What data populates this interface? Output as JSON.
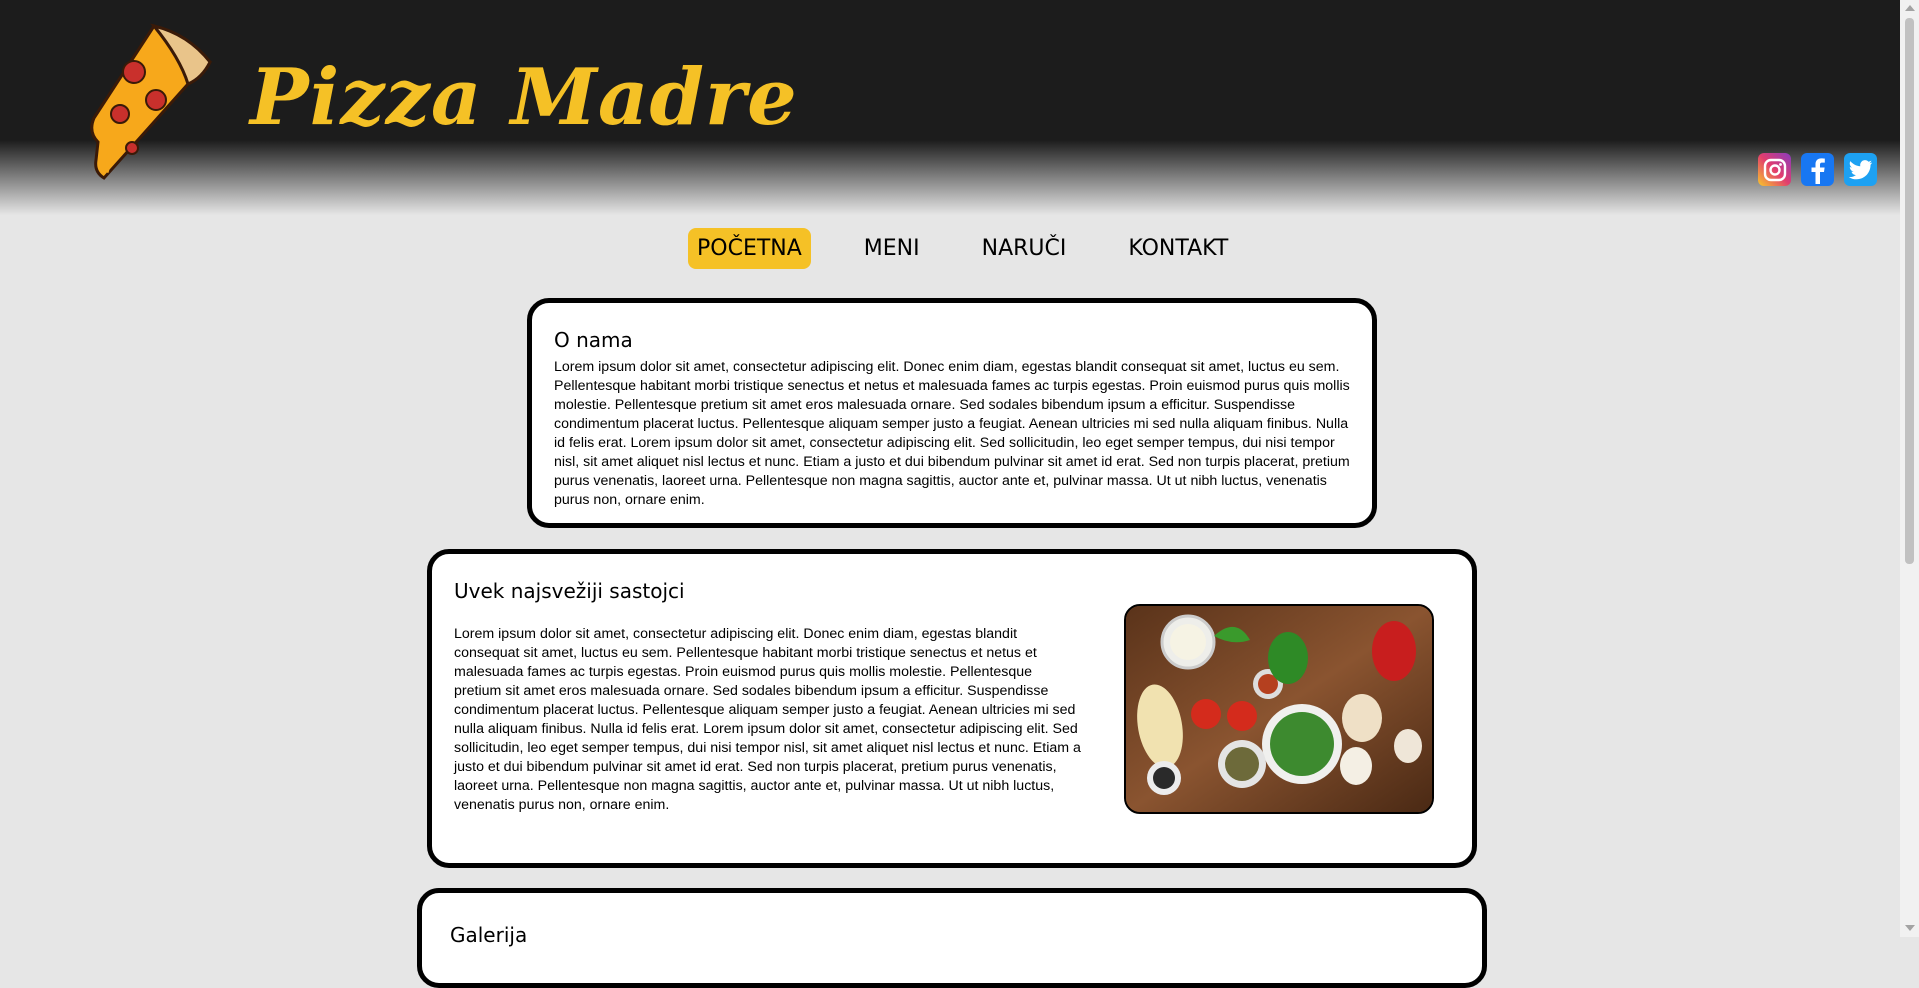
{
  "header": {
    "brand": "Pizza Madre",
    "logo_icon": "pizza-slice-icon",
    "brand_color": "#f5c126",
    "socials": [
      {
        "name": "instagram-icon"
      },
      {
        "name": "facebook-icon"
      },
      {
        "name": "twitter-icon"
      }
    ]
  },
  "nav": {
    "items": [
      {
        "label": "POČETNA",
        "active": true
      },
      {
        "label": "MENI"
      },
      {
        "label": "NARUČI"
      },
      {
        "label": "KONTAKT"
      }
    ],
    "active_color": "#f5c126"
  },
  "about": {
    "title": "O nama",
    "body": "Lorem ipsum dolor sit amet, consectetur adipiscing elit. Donec enim diam, egestas blandit consequat sit amet, luctus eu sem. Pellentesque habitant morbi tristique senectus et netus et malesuada fames ac turpis egestas. Proin euismod purus quis mollis molestie. Pellentesque pretium sit amet eros malesuada ornare. Sed sodales bibendum ipsum a efficitur. Suspendisse condimentum placerat luctus. Pellentesque aliquam semper justo a feugiat. Aenean ultricies mi sed nulla aliquam finibus. Nulla id felis erat. Lorem ipsum dolor sit amet, consectetur adipiscing elit. Sed sollicitudin, leo eget semper tempus, dui nisi tempor nisl, sit amet aliquet nisl lectus et nunc. Etiam a justo et dui bibendum pulvinar sit amet id erat. Sed non turpis placerat, pretium purus venenatis, laoreet urna. Pellentesque non magna sagittis, auctor ante et, pulvinar massa. Ut ut nibh luctus, venenatis purus non, ornare enim."
  },
  "ingredients": {
    "title": "Uvek najsvežiji sastojci",
    "body": "Lorem ipsum dolor sit amet, consectetur adipiscing elit. Donec enim diam, egestas blandit consequat sit amet, luctus eu sem. Pellentesque habitant morbi tristique senectus et netus et malesuada fames ac turpis egestas. Proin euismod purus quis mollis molestie. Pellentesque pretium sit amet eros malesuada ornare. Sed sodales bibendum ipsum a efficitur. Suspendisse condimentum placerat luctus. Pellentesque aliquam semper justo a feugiat. Aenean ultricies mi sed nulla aliquam finibus. Nulla id felis erat. Lorem ipsum dolor sit amet, consectetur adipiscing elit. Sed sollicitudin, leo eget semper tempus, dui nisi tempor nisl, sit amet aliquet nisl lectus et nunc. Etiam a justo et dui bibendum pulvinar sit amet id erat. Sed non turpis placerat, pretium purus venenatis, laoreet urna. Pellentesque non magna sagittis, auctor ante et, pulvinar massa. Ut ut nibh luctus, venenatis purus non, ornare enim."
  },
  "gallery": {
    "title": "Galerija"
  }
}
